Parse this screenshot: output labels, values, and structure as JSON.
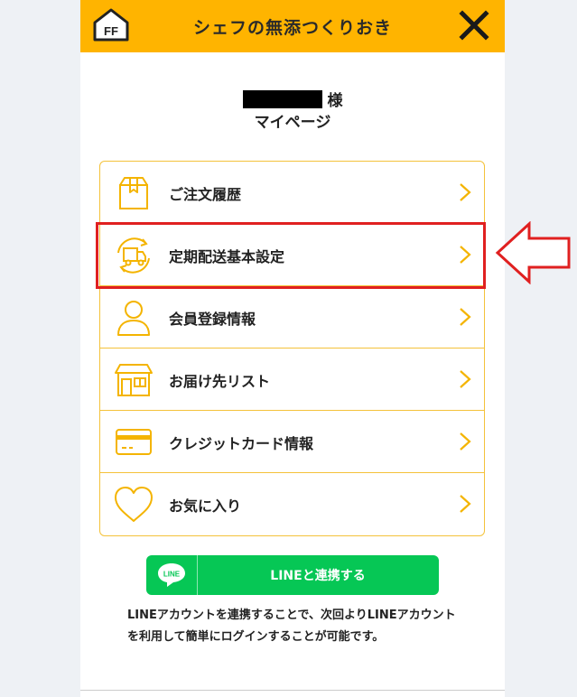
{
  "header": {
    "logo_text": "FF",
    "title": "シェフの無添つくりおき",
    "close_icon": "close-icon",
    "color": "#ffb400"
  },
  "greeting": {
    "suffix": "様",
    "page_label": "マイページ"
  },
  "menu": {
    "items": [
      {
        "label": "ご注文履歴",
        "icon": "package-icon"
      },
      {
        "label": "定期配送基本設定",
        "icon": "delivery-truck-icon"
      },
      {
        "label": "会員登録情報",
        "icon": "user-icon"
      },
      {
        "label": "お届け先リスト",
        "icon": "house-icon"
      },
      {
        "label": "クレジットカード情報",
        "icon": "credit-card-icon"
      },
      {
        "label": "お気に入り",
        "icon": "heart-icon"
      }
    ],
    "accent_color": "#f4c23a"
  },
  "line_button": {
    "logo_text": "LINE",
    "label": "LINEと連携する",
    "color": "#06c755"
  },
  "note": "LINEアカウントを連携することで、次回よりLINEアカウントを利用して簡単にログインすることが可能です。",
  "annotation": {
    "highlight_color": "#e02020"
  }
}
